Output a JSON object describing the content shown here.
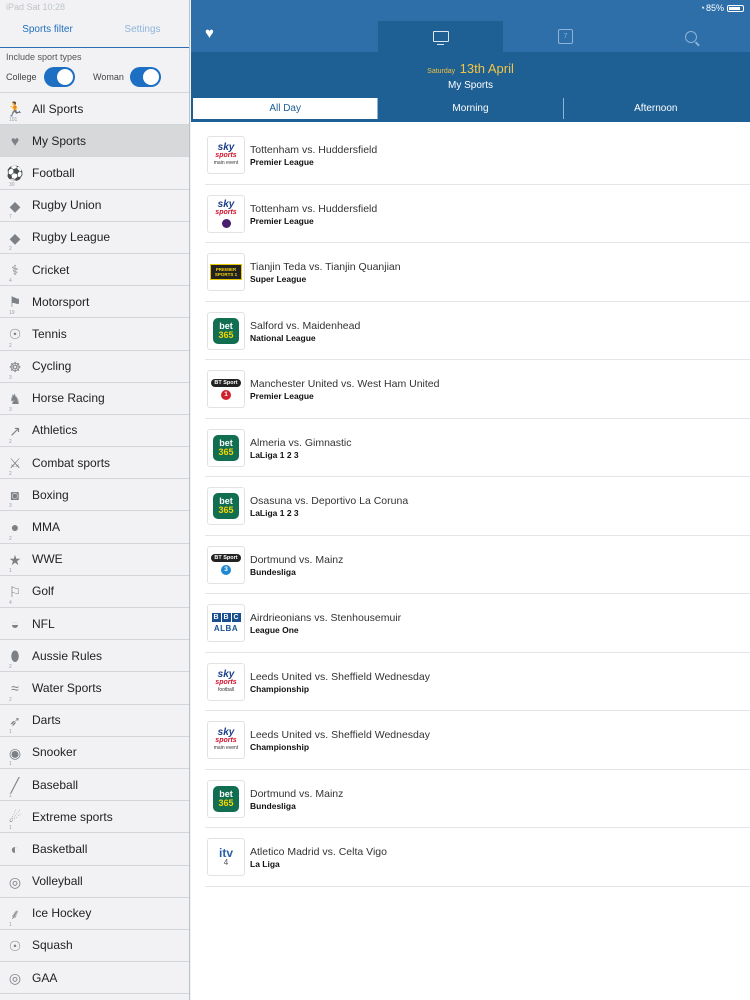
{
  "left_panel": {
    "status_text": "iPad  Sat 10:28",
    "tabs": {
      "filter": "Sports filter",
      "settings": "Settings"
    },
    "include_label": "Include sport types",
    "toggles": {
      "college": "College",
      "woman": "Woman"
    },
    "sports": [
      {
        "label": "All Sports",
        "icon": "running-person-icon",
        "count": "101"
      },
      {
        "label": "My Sports",
        "icon": "heart-icon",
        "count": ""
      },
      {
        "label": "Football",
        "icon": "soccer-ball-icon",
        "count": "30"
      },
      {
        "label": "Rugby Union",
        "icon": "rugby-ball-icon",
        "count": "7"
      },
      {
        "label": "Rugby League",
        "icon": "rugby-ball-icon",
        "count": "2"
      },
      {
        "label": "Cricket",
        "icon": "cricket-player-icon",
        "count": "4"
      },
      {
        "label": "Motorsport",
        "icon": "motorsport-icon",
        "count": "19"
      },
      {
        "label": "Tennis",
        "icon": "tennis-racket-icon",
        "count": "2"
      },
      {
        "label": "Cycling",
        "icon": "bicycle-icon",
        "count": "3"
      },
      {
        "label": "Horse Racing",
        "icon": "horse-icon",
        "count": "3"
      },
      {
        "label": "Athletics",
        "icon": "runner-icon",
        "count": "2"
      },
      {
        "label": "Combat sports",
        "icon": "martial-arts-icon",
        "count": "2"
      },
      {
        "label": "Boxing",
        "icon": "boxing-glove-icon",
        "count": "3"
      },
      {
        "label": "MMA",
        "icon": "fist-icon",
        "count": "2"
      },
      {
        "label": "WWE",
        "icon": "star-icon",
        "count": "1"
      },
      {
        "label": "Golf",
        "icon": "golf-flag-icon",
        "count": "4"
      },
      {
        "label": "NFL",
        "icon": "football-helmet-icon",
        "count": ""
      },
      {
        "label": "Aussie Rules",
        "icon": "aussie-rules-ball-icon",
        "count": "2"
      },
      {
        "label": "Water Sports",
        "icon": "swimmer-icon",
        "count": "2"
      },
      {
        "label": "Darts",
        "icon": "dart-icon",
        "count": "1"
      },
      {
        "label": "Snooker",
        "icon": "snooker-ball-icon",
        "count": "1"
      },
      {
        "label": "Baseball",
        "icon": "baseball-bat-icon",
        "count": "1"
      },
      {
        "label": "Extreme sports",
        "icon": "extreme-sports-icon",
        "count": "1"
      },
      {
        "label": "Basketball",
        "icon": "basketball-icon",
        "count": ""
      },
      {
        "label": "Volleyball",
        "icon": "volleyball-icon",
        "count": ""
      },
      {
        "label": "Ice Hockey",
        "icon": "hockey-stick-icon",
        "count": "1"
      },
      {
        "label": "Squash",
        "icon": "squash-racket-icon",
        "count": ""
      },
      {
        "label": "GAA",
        "icon": "gaa-ball-icon",
        "count": ""
      }
    ]
  },
  "right_panel": {
    "status": {
      "battery": "85%"
    },
    "nav_tabs": {
      "calendar_day": "7"
    },
    "date": {
      "day_name": "Saturday",
      "date": "13th April"
    },
    "section_title": "My Sports",
    "segments": [
      "All Day",
      "Morning",
      "Afternoon"
    ],
    "matches": [
      {
        "teams": "Tottenham vs. Huddersfield",
        "competition": "Premier League",
        "channel": "sky-main-event",
        "channel_text": [
          "sky",
          "sports",
          "main event"
        ]
      },
      {
        "teams": "Tottenham vs. Huddersfield",
        "competition": "Premier League",
        "channel": "sky-premier-league",
        "channel_text": [
          "sky",
          "sports"
        ]
      },
      {
        "teams": "Tianjin Teda vs. Tianjin Quanjian",
        "competition": "Super League",
        "channel": "premier-sports",
        "channel_text": [
          "PREMIER SPORTS 1"
        ]
      },
      {
        "teams": "Salford vs. Maidenhead",
        "competition": "National League",
        "channel": "bet365",
        "channel_text": [
          "bet",
          "365"
        ]
      },
      {
        "teams": "Manchester United vs. West Ham United",
        "competition": "Premier League",
        "channel": "bt-sport-1",
        "channel_text": [
          "BT Sport",
          "1"
        ]
      },
      {
        "teams": "Almeria vs. Gimnastic",
        "competition": "LaLiga 1 2 3",
        "channel": "bet365",
        "channel_text": [
          "bet",
          "365"
        ]
      },
      {
        "teams": "Osasuna vs. Deportivo La Coruna",
        "competition": "LaLiga 1 2 3",
        "channel": "bet365",
        "channel_text": [
          "bet",
          "365"
        ]
      },
      {
        "teams": "Dortmund vs. Mainz",
        "competition": "Bundesliga",
        "channel": "bt-sport-3",
        "channel_text": [
          "BT Sport",
          "3"
        ]
      },
      {
        "teams": "Airdrieonians vs. Stenhousemuir",
        "competition": "League One",
        "channel": "bbc-alba",
        "channel_text": [
          "B",
          "B",
          "C",
          "ALBA"
        ]
      },
      {
        "teams": "Leeds United vs. Sheffield Wednesday",
        "competition": "Championship",
        "channel": "sky-football",
        "channel_text": [
          "sky",
          "sports",
          "football"
        ]
      },
      {
        "teams": "Leeds United vs. Sheffield Wednesday",
        "competition": "Championship",
        "channel": "sky-main-event",
        "channel_text": [
          "sky",
          "sports",
          "main event"
        ]
      },
      {
        "teams": "Dortmund vs. Mainz",
        "competition": "Bundesliga",
        "channel": "bet365",
        "channel_text": [
          "bet",
          "365"
        ]
      },
      {
        "teams": "Atletico Madrid vs. Celta Vigo",
        "competition": "La Liga",
        "channel": "itv4",
        "channel_text": [
          "itv",
          "4"
        ]
      }
    ]
  },
  "colors": {
    "accent": "#2e6faa",
    "accent_dark": "#1e5f94",
    "date": "#f5c542",
    "bet365": "#126e51"
  }
}
